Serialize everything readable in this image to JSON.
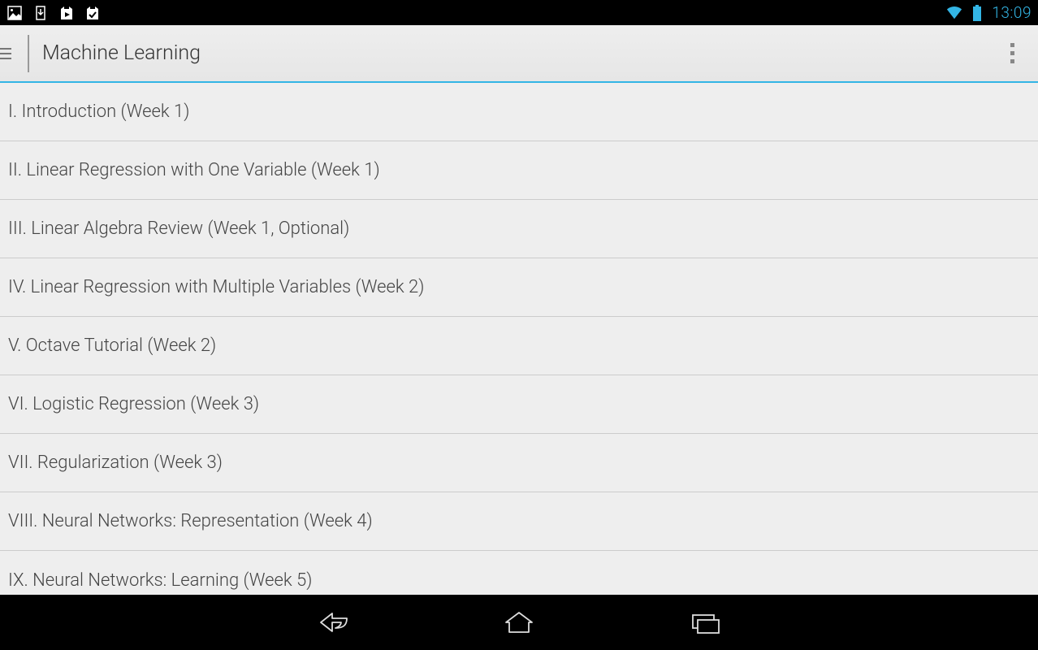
{
  "statusBar": {
    "time": "13:09",
    "accentColor": "#33b5e5"
  },
  "appBar": {
    "title": "Machine Learning"
  },
  "lessons": [
    {
      "label": "I. Introduction (Week 1)"
    },
    {
      "label": "II. Linear Regression with One Variable (Week 1)"
    },
    {
      "label": "III. Linear Algebra Review (Week 1, Optional)"
    },
    {
      "label": "IV. Linear Regression with Multiple Variables (Week 2)"
    },
    {
      "label": "V. Octave Tutorial (Week 2)"
    },
    {
      "label": "VI. Logistic Regression (Week 3)"
    },
    {
      "label": "VII. Regularization (Week 3)"
    },
    {
      "label": "VIII. Neural Networks: Representation (Week 4)"
    },
    {
      "label": "IX. Neural Networks: Learning (Week 5)"
    }
  ]
}
